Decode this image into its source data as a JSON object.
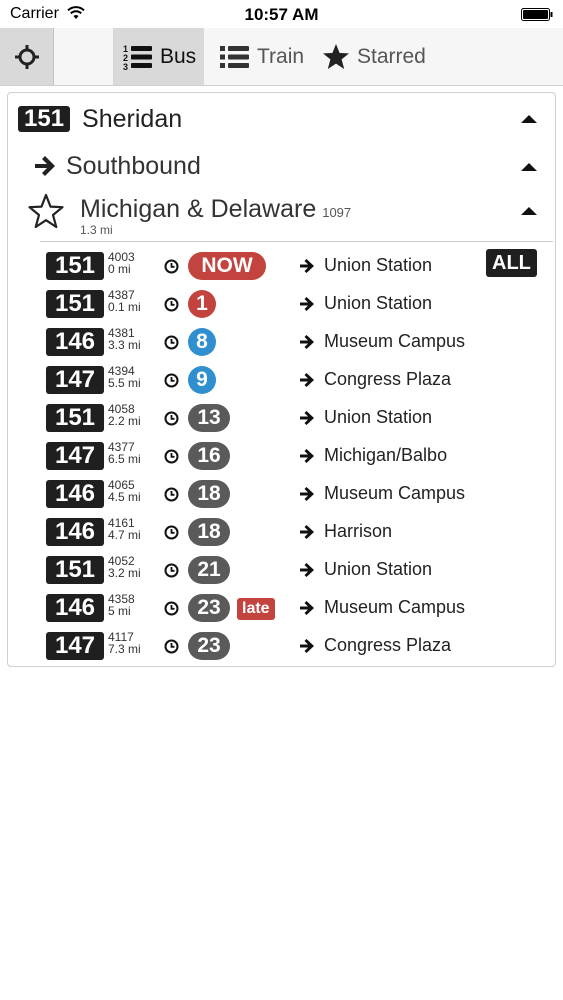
{
  "status_bar": {
    "carrier": "Carrier",
    "time": "10:57 AM"
  },
  "toolbar": {
    "locate_icon": "crosshair-icon",
    "tabs": [
      {
        "label": "Bus",
        "icon": "numbered-list-icon",
        "active": true
      },
      {
        "label": "Train",
        "icon": "list-icon",
        "active": false
      },
      {
        "label": "Starred",
        "icon": "star-icon",
        "active": false
      }
    ]
  },
  "route": {
    "number": "151",
    "name": "Sheridan",
    "direction": "Southbound",
    "stop": {
      "name": "Michigan & Delaware",
      "id": "1097",
      "distance": "1.3 mi",
      "starred": false
    }
  },
  "all_button": "ALL",
  "colors": {
    "now": "#c3443e",
    "blue": "#2f8fcf",
    "gray": "#5a5a5a",
    "badge": "#1f1f1f",
    "late": "#c3443e"
  },
  "arrivals": [
    {
      "route": "151",
      "vehicle": "4003",
      "distance": "0 mi",
      "eta": "NOW",
      "eta_style": "now",
      "late": "",
      "destination": "Union Station"
    },
    {
      "route": "151",
      "vehicle": "4387",
      "distance": "0.1 mi",
      "eta": "1",
      "eta_style": "now",
      "late": "",
      "destination": "Union Station"
    },
    {
      "route": "146",
      "vehicle": "4381",
      "distance": "3.3 mi",
      "eta": "8",
      "eta_style": "blue",
      "late": "",
      "destination": "Museum Campus"
    },
    {
      "route": "147",
      "vehicle": "4394",
      "distance": "5.5 mi",
      "eta": "9",
      "eta_style": "blue",
      "late": "",
      "destination": "Congress Plaza"
    },
    {
      "route": "151",
      "vehicle": "4058",
      "distance": "2.2 mi",
      "eta": "13",
      "eta_style": "gray",
      "late": "",
      "destination": "Union Station"
    },
    {
      "route": "147",
      "vehicle": "4377",
      "distance": "6.5 mi",
      "eta": "16",
      "eta_style": "gray",
      "late": "",
      "destination": "Michigan/Balbo"
    },
    {
      "route": "146",
      "vehicle": "4065",
      "distance": "4.5 mi",
      "eta": "18",
      "eta_style": "gray",
      "late": "",
      "destination": "Museum Campus"
    },
    {
      "route": "146",
      "vehicle": "4161",
      "distance": "4.7 mi",
      "eta": "18",
      "eta_style": "gray",
      "late": "",
      "destination": "Harrison"
    },
    {
      "route": "151",
      "vehicle": "4052",
      "distance": "3.2 mi",
      "eta": "21",
      "eta_style": "gray",
      "late": "",
      "destination": "Union Station"
    },
    {
      "route": "146",
      "vehicle": "4358",
      "distance": "5 mi",
      "eta": "23",
      "eta_style": "gray",
      "late": "late",
      "destination": "Museum Campus"
    },
    {
      "route": "147",
      "vehicle": "4117",
      "distance": "7.3 mi",
      "eta": "23",
      "eta_style": "gray",
      "late": "",
      "destination": "Congress Plaza"
    }
  ]
}
